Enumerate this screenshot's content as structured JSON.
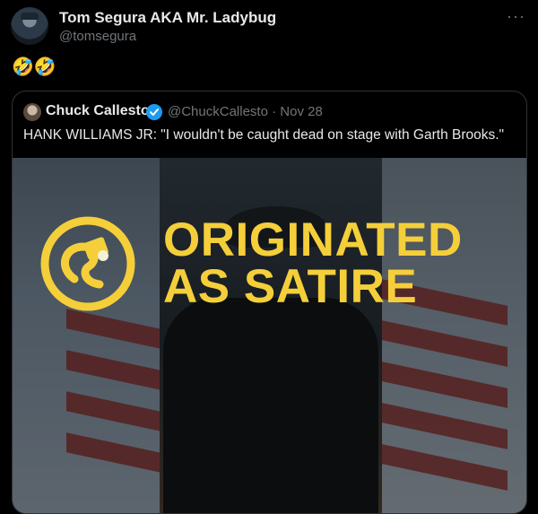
{
  "tweet": {
    "author_name": "Tom Segura AKA Mr. Ladybug",
    "author_handle": "@tomsegura",
    "more_label": "···",
    "text": "🤣🤣"
  },
  "quote": {
    "author_name": "Chuck Callesto",
    "author_handle": "@ChuckCallesto",
    "separator": " · ",
    "date": "Nov 28",
    "text": "HANK WILLIAMS JR: \"I wouldn't be caught dead on stage with Garth Brooks.\"",
    "media": {
      "headline_line1": "ORIGINATED",
      "headline_line2": "AS SATIRE",
      "accent_color": "#f5cf3a"
    }
  },
  "colors": {
    "background": "#000000",
    "text_primary": "#e7e9ea",
    "text_secondary": "#71767b",
    "border": "#2f3336",
    "verified": "#1d9bf0"
  }
}
